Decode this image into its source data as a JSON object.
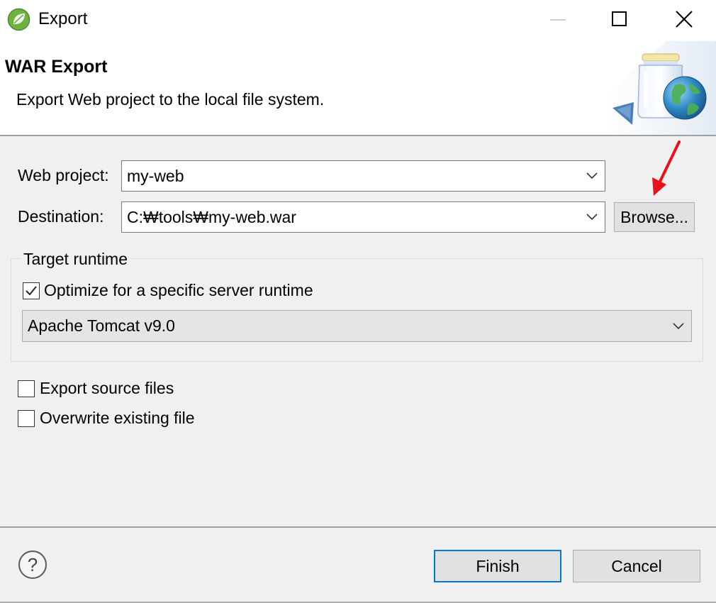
{
  "window": {
    "title": "Export",
    "icon": "spring-leaf-icon",
    "controls": [
      "minimize-icon",
      "maximize-icon",
      "close-icon"
    ]
  },
  "banner": {
    "title": "WAR Export",
    "description": "Export Web project to the local file system.",
    "image": "jar-globe-icon"
  },
  "form": {
    "web_project_label": "Web project:",
    "web_project_value": "my-web",
    "destination_label": "Destination:",
    "destination_value": "C:₩tools₩my-web.war",
    "browse_label": "Browse..."
  },
  "target_runtime": {
    "group_label": "Target runtime",
    "optimize_label": "Optimize for a specific server runtime",
    "optimize_checked": true,
    "runtime_value": "Apache Tomcat v9.0"
  },
  "options": {
    "export_source_label": "Export source files",
    "export_source_checked": false,
    "overwrite_label": "Overwrite existing file",
    "overwrite_checked": false
  },
  "footer": {
    "help_icon": "help-icon",
    "finish_label": "Finish",
    "cancel_label": "Cancel"
  },
  "annotation": {
    "arrow_color": "#e8121b"
  }
}
